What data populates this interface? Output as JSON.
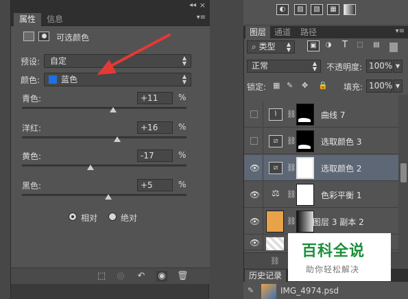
{
  "properties_panel": {
    "tabs": [
      {
        "label": "属性"
      },
      {
        "label": "信息"
      }
    ],
    "adjustment_title": "可选颜色",
    "preset_label": "预设:",
    "preset_value": "自定",
    "colors_label": "颜色:",
    "colors_value": "蓝色",
    "colors_swatch": "#1f6fe5",
    "sliders": [
      {
        "label": "青色:",
        "value": "+11",
        "unit": "%",
        "level": 0.555
      },
      {
        "label": "洋红:",
        "value": "+16",
        "unit": "%",
        "level": 0.58
      },
      {
        "label": "黄色:",
        "value": "-17",
        "unit": "%",
        "level": 0.415
      },
      {
        "label": "黑色:",
        "value": "+5",
        "unit": "%",
        "level": 0.525
      }
    ],
    "method_options": [
      {
        "label": "相对",
        "selected": true
      },
      {
        "label": "绝对",
        "selected": false
      }
    ],
    "footer_icons": [
      "clip-to-layer-icon",
      "view-previous-icon",
      "reset-icon",
      "visibility-icon",
      "trash-icon"
    ]
  },
  "layers_panel": {
    "tabs": [
      {
        "label": "图层"
      },
      {
        "label": "通道"
      },
      {
        "label": "路径"
      }
    ],
    "filter_label": "类型",
    "blend_mode": "正常",
    "opacity_label": "不透明度:",
    "opacity_value": "100%",
    "lock_label": "锁定:",
    "fill_label": "填充:",
    "fill_value": "100%",
    "layers": [
      {
        "name": "曲线 7",
        "visible": false,
        "selected": false,
        "icon": "curves-icon",
        "mask": "dark"
      },
      {
        "name": "选取颜色 3",
        "visible": false,
        "selected": false,
        "icon": "selective-color-icon",
        "mask": "dark"
      },
      {
        "name": "选取颜色 2",
        "visible": true,
        "selected": true,
        "icon": "selective-color-icon",
        "mask": "white"
      },
      {
        "name": "色彩平衡 1",
        "visible": true,
        "selected": false,
        "icon": "color-balance-icon",
        "mask": "white"
      },
      {
        "name": "图层 3 副本 2",
        "visible": true,
        "selected": false,
        "icon": "image-thumb",
        "mask": "gradient"
      }
    ]
  },
  "history_panel": {
    "tab_label": "历史记录",
    "item_label": "IMG_4974.psd"
  },
  "watermark": {
    "title": "百科全说",
    "subtitle": "助你轻松解决"
  }
}
